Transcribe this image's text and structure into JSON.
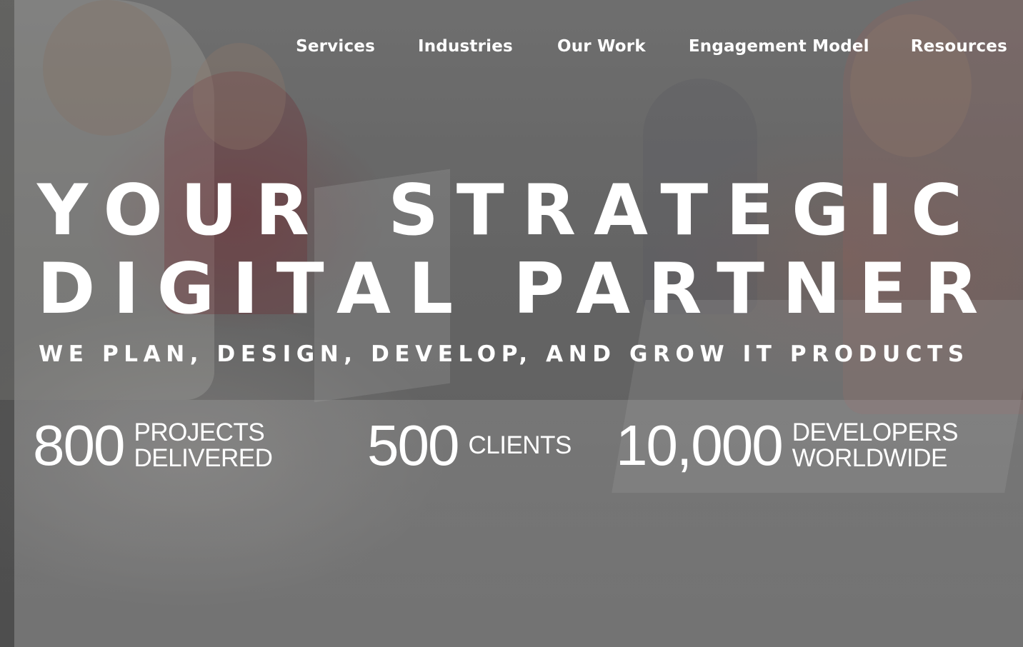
{
  "nav": {
    "items": [
      {
        "label": "Services"
      },
      {
        "label": "Industries"
      },
      {
        "label": "Our Work"
      },
      {
        "label": "Engagement Model"
      },
      {
        "label": "Resources"
      }
    ]
  },
  "hero": {
    "headline_line1_word1": "YOUR",
    "headline_line1_word2": "STRATEGIC",
    "headline_line2": "DIGITAL PARTNER",
    "subheadline": "WE PLAN, DESIGN, DEVELOP, AND GROW IT PRODUCTS"
  },
  "stats": [
    {
      "value": "800",
      "label_line1": "PROJECTS",
      "label_line2": "DELIVERED"
    },
    {
      "value": "500",
      "label_line1": "CLIENTS",
      "label_line2": ""
    },
    {
      "value": "10,000",
      "label_line1": "DEVELOPERS",
      "label_line2": "WORLDWIDE"
    }
  ]
}
